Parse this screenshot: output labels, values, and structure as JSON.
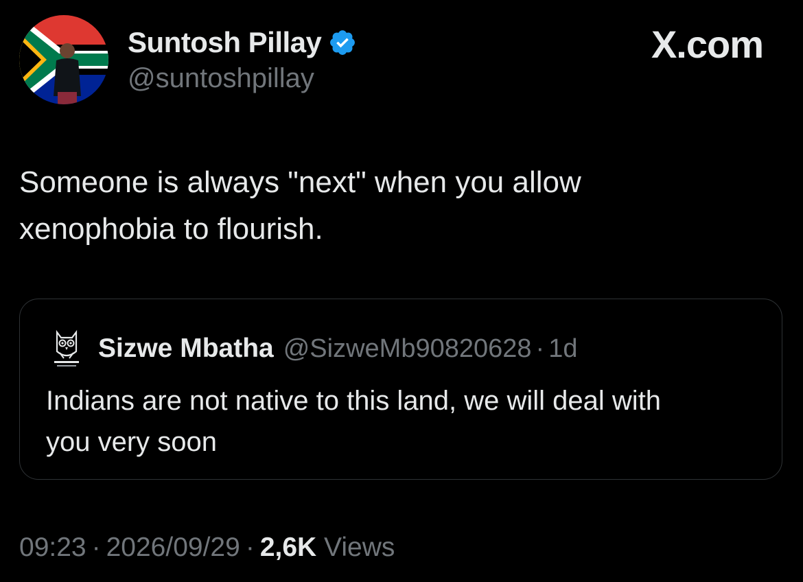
{
  "author": {
    "display_name": "Suntosh Pillay",
    "handle": "@suntoshpillay",
    "verified_icon": "verified-badge-icon",
    "verified_color": "#1d9bf0"
  },
  "brand": {
    "label": "X.com"
  },
  "tweet": {
    "text_line1": "Someone is always \"next\" when you allow",
    "text_line2": "xenophobia to flourish."
  },
  "quote": {
    "display_name": "Sizwe Mbatha",
    "handle": "@SizweMb90820628",
    "separator": "·",
    "time": "1d",
    "text_line1": "Indians are not native to this land, we will deal with",
    "text_line2": "you very soon",
    "avatar_icon": "owl-icon"
  },
  "meta": {
    "time": "09:23",
    "date": "2026/09/29",
    "separator": "·",
    "views_count": "2,6K",
    "views_label": "Views"
  },
  "colors": {
    "background": "#000000",
    "text_primary": "#e7e9ea",
    "text_secondary": "#71767b",
    "border": "#2f3336"
  }
}
